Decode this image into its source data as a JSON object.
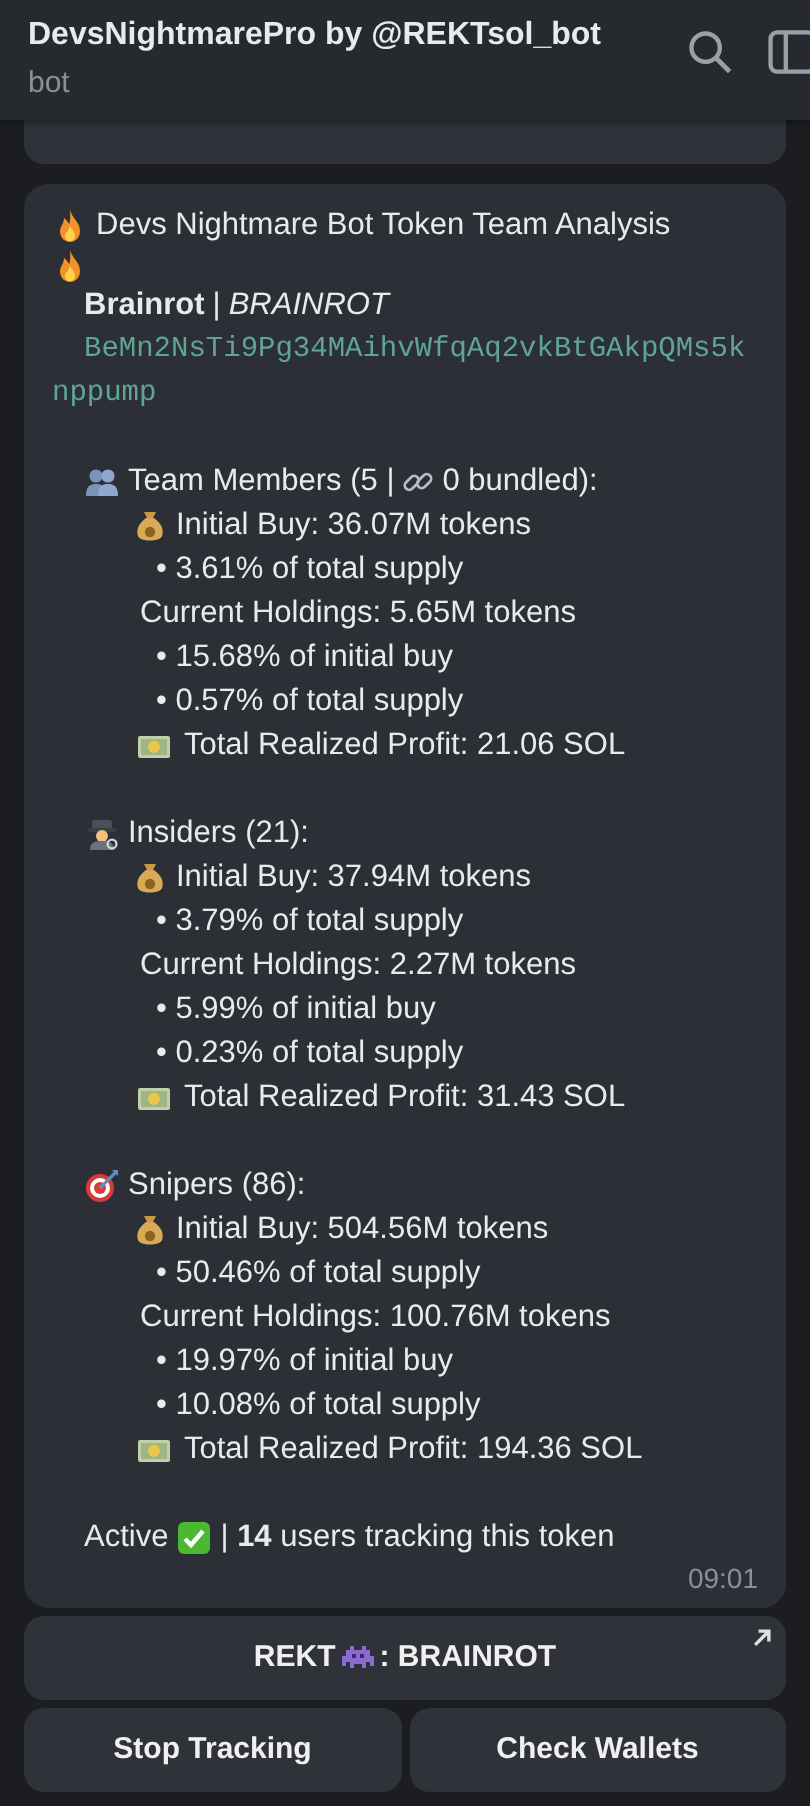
{
  "header": {
    "title": "DevsNightmarePro by @REKTsol_bot",
    "subtitle": "bot"
  },
  "message": {
    "title": "Devs Nightmare Bot Token Team Analysis",
    "token_name": "Brainrot",
    "separator": "|",
    "token_symbol": "BRAINROT",
    "address": "BeMn2NsTi9Pg34MAihvWfqAq2vkBtGAkpQMs5knppump",
    "sections": [
      {
        "kind": "team",
        "heading": [
          "Team Members (5 |",
          "0 bundled):"
        ],
        "lines": [
          {
            "kind": "buy",
            "text": "Initial Buy: 36.07M tokens"
          },
          {
            "kind": "bullet",
            "text": "• 3.61% of total supply"
          },
          {
            "kind": "plain",
            "text": "Current Holdings: 5.65M tokens"
          },
          {
            "kind": "bullet",
            "text": "• 15.68% of initial buy"
          },
          {
            "kind": "bullet",
            "text": "• 0.57% of total supply"
          },
          {
            "kind": "profit",
            "text": "Total Realized Profit: 21.06 SOL"
          }
        ]
      },
      {
        "kind": "insiders",
        "heading": [
          "Insiders (21):"
        ],
        "lines": [
          {
            "kind": "buy",
            "text": "Initial Buy: 37.94M tokens"
          },
          {
            "kind": "bullet",
            "text": "• 3.79% of total supply"
          },
          {
            "kind": "plain",
            "text": "Current Holdings: 2.27M tokens"
          },
          {
            "kind": "bullet",
            "text": "• 5.99% of initial buy"
          },
          {
            "kind": "bullet",
            "text": "• 0.23% of total supply"
          },
          {
            "kind": "profit",
            "text": "Total Realized Profit: 31.43 SOL"
          }
        ]
      },
      {
        "kind": "snipers",
        "heading": [
          "Snipers (86):"
        ],
        "lines": [
          {
            "kind": "buy",
            "text": "Initial Buy: 504.56M tokens"
          },
          {
            "kind": "bullet",
            "text": "• 50.46% of total supply"
          },
          {
            "kind": "plain",
            "text": "Current Holdings: 100.76M tokens"
          },
          {
            "kind": "bullet",
            "text": "• 19.97% of initial buy"
          },
          {
            "kind": "bullet",
            "text": "• 10.08% of total supply"
          },
          {
            "kind": "profit",
            "text": "Total Realized Profit: 194.36 SOL"
          }
        ]
      }
    ],
    "status": "Active",
    "tracking": "| **14** users tracking this token",
    "time": "09:01"
  },
  "keyboard": [
    [
      {
        "kind": "link",
        "label": [
          "REKT",
          ": BRAINROT"
        ]
      }
    ],
    [
      {
        "kind": "plain",
        "label": [
          "Stop Tracking"
        ]
      },
      {
        "kind": "plain",
        "label": [
          "Check Wallets"
        ]
      }
    ]
  ]
}
